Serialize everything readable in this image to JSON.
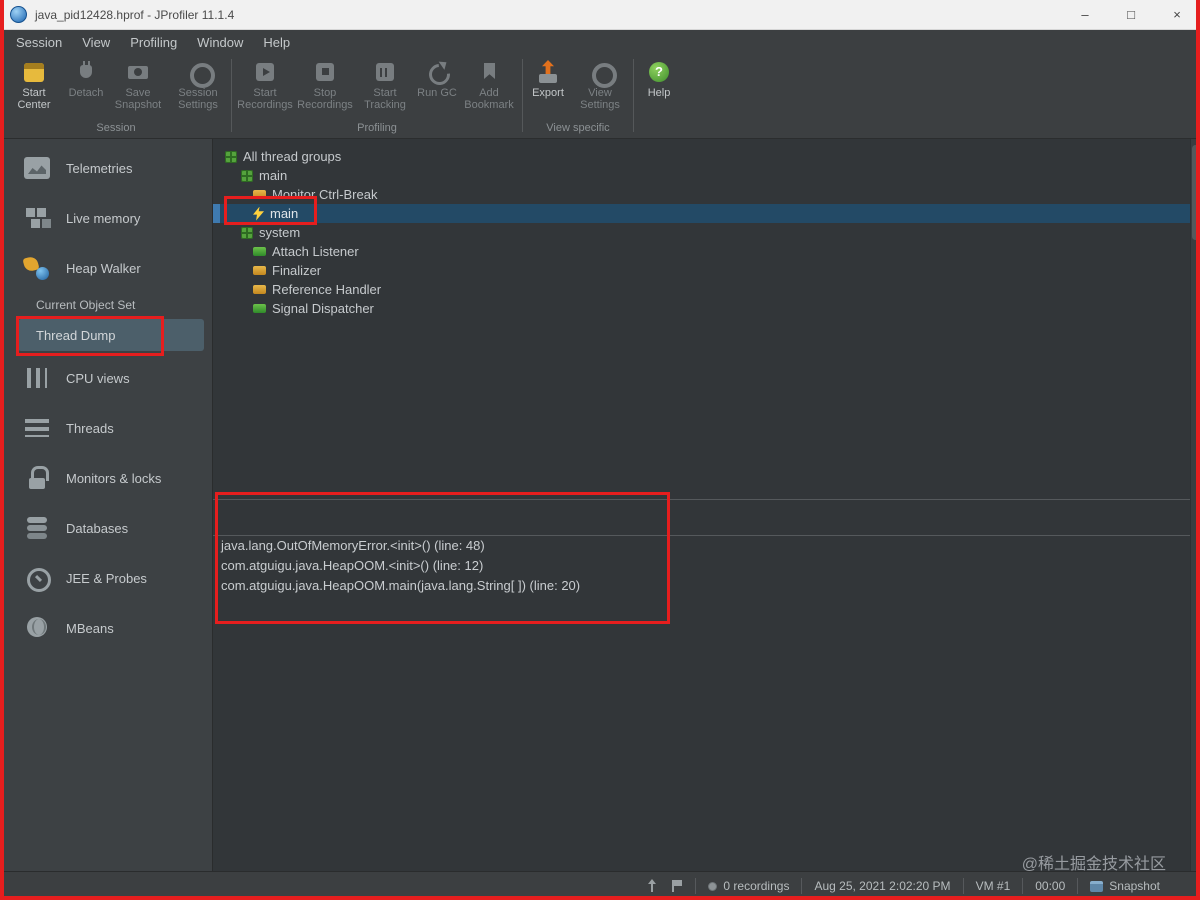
{
  "window": {
    "title": "java_pid12428.hprof - JProfiler 11.1.4",
    "controls": {
      "minimize": "–",
      "maximize": "□",
      "close": "×"
    }
  },
  "menubar": {
    "items": [
      "Session",
      "View",
      "Profiling",
      "Window",
      "Help"
    ]
  },
  "toolbar": {
    "groups": [
      {
        "label": "Session",
        "buttons": [
          {
            "label": "Start Center",
            "enabled": true
          },
          {
            "label": "Detach",
            "enabled": false
          },
          {
            "label": "Save Snapshot",
            "enabled": false
          },
          {
            "label": "Session Settings",
            "enabled": false
          }
        ]
      },
      {
        "label": "Profiling",
        "buttons": [
          {
            "label": "Start Recordings",
            "enabled": false
          },
          {
            "label": "Stop Recordings",
            "enabled": false
          },
          {
            "label": "Start Tracking",
            "enabled": false
          },
          {
            "label": "Run GC",
            "enabled": false
          },
          {
            "label": "Add Bookmark",
            "enabled": false
          }
        ]
      },
      {
        "label": "View specific",
        "buttons": [
          {
            "label": "Export",
            "enabled": true
          },
          {
            "label": "View Settings",
            "enabled": false
          }
        ]
      },
      {
        "label": "",
        "buttons": [
          {
            "label": "Help",
            "enabled": true
          }
        ]
      }
    ]
  },
  "sidebar": {
    "items": [
      {
        "label": "Telemetries"
      },
      {
        "label": "Live memory"
      },
      {
        "label": "Heap Walker"
      },
      {
        "label": "Current Object Set"
      },
      {
        "label": "Thread Dump",
        "selected": true
      },
      {
        "label": "CPU views"
      },
      {
        "label": "Threads"
      },
      {
        "label": "Monitors & locks"
      },
      {
        "label": "Databases"
      },
      {
        "label": "JEE & Probes"
      },
      {
        "label": "MBeans"
      }
    ]
  },
  "thread_tree": {
    "rows": [
      {
        "label": "All thread groups",
        "indent": 0,
        "icon": "thread-group",
        "selected": false
      },
      {
        "label": "main",
        "indent": 1,
        "icon": "thread-group",
        "selected": false
      },
      {
        "label": "Monitor Ctrl-Break",
        "indent": 2,
        "icon": "thread-waiting",
        "selected": false
      },
      {
        "label": "main",
        "indent": 2,
        "icon": "thread-running-bolt",
        "selected": true
      },
      {
        "label": "system",
        "indent": 1,
        "icon": "thread-group",
        "selected": false
      },
      {
        "label": "Attach Listener",
        "indent": 2,
        "icon": "thread-runnable",
        "selected": false
      },
      {
        "label": "Finalizer",
        "indent": 2,
        "icon": "thread-waiting",
        "selected": false
      },
      {
        "label": "Reference Handler",
        "indent": 2,
        "icon": "thread-waiting",
        "selected": false
      },
      {
        "label": "Signal Dispatcher",
        "indent": 2,
        "icon": "thread-runnable",
        "selected": false
      }
    ]
  },
  "stack_panel": {
    "lines": [
      {
        "text": "java.lang.OutOfMemoryError.<init>() (line: 48)"
      },
      {
        "text": "com.atguigu.java.HeapOOM.<init>() (line: 12)"
      },
      {
        "text": "com.atguigu.java.HeapOOM.main(java.lang.String[ ]) (line: 20)"
      }
    ]
  },
  "statusbar": {
    "recordings": "0 recordings",
    "timestamp": "Aug 25, 2021 2:02:20 PM",
    "vm_label": "VM #1",
    "elapsed": "00:00",
    "snapshot_label": "Snapshot"
  },
  "watermark": "@稀土掘金技术社区",
  "colors": {
    "selection_blue": "#234a66",
    "annotation_red": "#e61e1e",
    "thread_green": "#2f8a2a",
    "thread_orange": "#c4881f",
    "sidebar_selected": "#4c5f6a"
  }
}
